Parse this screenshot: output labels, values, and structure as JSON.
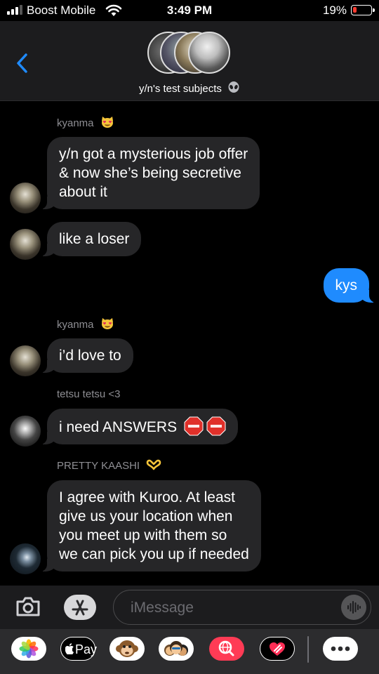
{
  "status_bar": {
    "carrier": "Boost Mobile",
    "time": "3:49 PM",
    "battery_percent": "19%",
    "battery_level": 0.19
  },
  "header": {
    "title": "y/n's test subjects",
    "title_emoji_icon": "alien-icon",
    "back_icon": "chevron-left-icon"
  },
  "messages": [
    {
      "sender": "kyanma",
      "sender_emoji_icon": "heart-eyes-cat-icon",
      "lines": [
        "y/n got a mysterious job offer",
        "& now she’s being secretive",
        "about it"
      ]
    },
    {
      "lines": [
        "like a loser"
      ]
    },
    {
      "outgoing": true,
      "lines": [
        "kys"
      ]
    },
    {
      "sender": "kyanma",
      "sender_emoji_icon": "heart-eyes-cat-icon",
      "lines": [
        "i’d love to"
      ]
    },
    {
      "sender": "tetsu tetsu <3",
      "lines": [
        "i need ANSWERS"
      ],
      "trailing_icons": [
        "stop-sign-icon",
        "stop-sign-icon"
      ]
    },
    {
      "sender": "PRETTY KAASHI",
      "sender_emoji_icon": "heart-hands-icon",
      "lines": [
        "I agree with Kuroo. At least",
        "give us your location when",
        "you meet up with them so",
        "we can pick you up if needed"
      ]
    }
  ],
  "compose": {
    "placeholder": "iMessage"
  },
  "app_drawer": {
    "apple_pay_label": "Pay",
    "apps": [
      "photos-icon",
      "apple-pay-icon",
      "monkey-memoji-icon",
      "memoji-icon",
      "web-search-icon",
      "digital-touch-icon",
      "more-apps-icon"
    ]
  },
  "colors": {
    "incoming_bubble": "#262628",
    "outgoing_bubble": "#1f8bfe",
    "background": "#000000",
    "battery_low": "#ff3b30"
  }
}
